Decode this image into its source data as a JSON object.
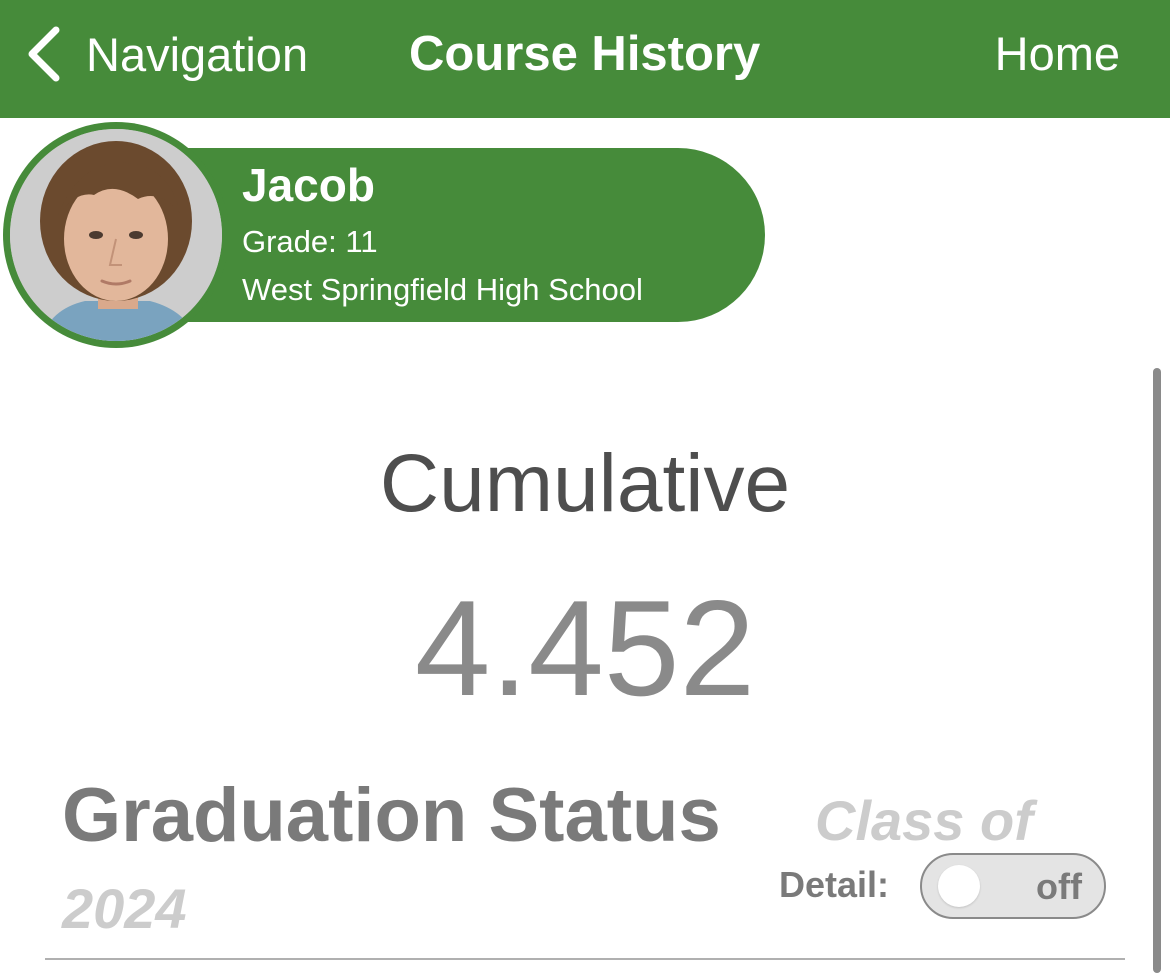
{
  "navbar": {
    "back_label": "Navigation",
    "title": "Course History",
    "home_label": "Home"
  },
  "student": {
    "name": "Jacob",
    "grade": "Grade: 11",
    "school": "West Springfield High School",
    "avatar": "student-photo"
  },
  "gpa": {
    "label": "Cumulative",
    "value": "4.452"
  },
  "graduation": {
    "title": "Graduation Status",
    "class_of_prefix": "Class of",
    "class_year": "2024",
    "detail_label": "Detail:",
    "detail_toggle": {
      "state": "off",
      "text": "off"
    }
  },
  "colors": {
    "brand_green": "#468b3a",
    "heading_gray": "#4e4e4e",
    "value_gray": "#8a8a8a",
    "muted_gray": "#cccccc"
  },
  "icons": {
    "back": "chevron-left-icon"
  }
}
